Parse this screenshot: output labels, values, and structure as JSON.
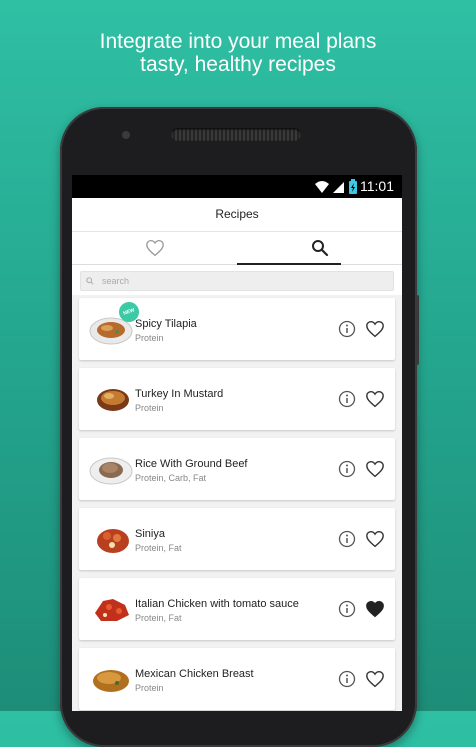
{
  "tagline": {
    "line1": "Integrate into your meal plans",
    "line2": "tasty, healthy recipes"
  },
  "statusbar": {
    "time": "11:01",
    "icons": [
      "wifi-icon",
      "signal-icon",
      "battery-icon"
    ]
  },
  "appbar": {
    "title": "Recipes"
  },
  "tabs": [
    {
      "icon": "heart-outline-icon",
      "selected": false
    },
    {
      "icon": "search-icon",
      "selected": true
    }
  ],
  "search": {
    "placeholder": "search"
  },
  "recipes": [
    {
      "title": "Spicy Tilapia",
      "categories": "Protein",
      "favorite": false,
      "badge": "NEW"
    },
    {
      "title": "Turkey In Mustard",
      "categories": "Protein",
      "favorite": false
    },
    {
      "title": "Rice With Ground Beef",
      "categories": "Protein, Carb, Fat",
      "favorite": false
    },
    {
      "title": "Siniya",
      "categories": "Protein, Fat",
      "favorite": false
    },
    {
      "title": "Italian Chicken with tomato sauce",
      "categories": "Protein, Fat",
      "favorite": true
    },
    {
      "title": "Mexican Chicken Breast",
      "categories": "Protein",
      "favorite": false
    }
  ],
  "colors": {
    "background_top": "#2fc0a4",
    "background_bottom": "#1d8d78",
    "accent": "#3cc9a6"
  }
}
